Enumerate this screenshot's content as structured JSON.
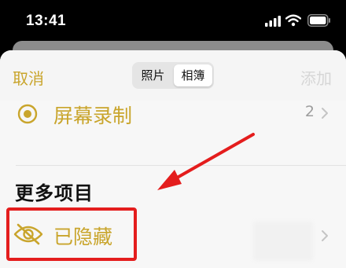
{
  "status_bar": {
    "time": "13:41",
    "icons": [
      "cellular-signal-icon",
      "wifi-icon",
      "battery-icon"
    ]
  },
  "nav": {
    "cancel_label": "取消",
    "add_label": "添加",
    "segments": [
      "照片",
      "相簿"
    ],
    "selected_segment": "相簿"
  },
  "rows": {
    "screen_recording": {
      "label": "屏幕录制",
      "count": "2",
      "icon": "record-icon"
    },
    "hidden": {
      "label": "已隐藏",
      "icon": "eye-slash-icon"
    }
  },
  "section": {
    "more_items": "更多项目"
  },
  "colors": {
    "accent": "#c9a52c",
    "annotation_red": "#e41d1d",
    "disabled": "#d6d6d6",
    "secondary_text": "#9d9d9d"
  }
}
